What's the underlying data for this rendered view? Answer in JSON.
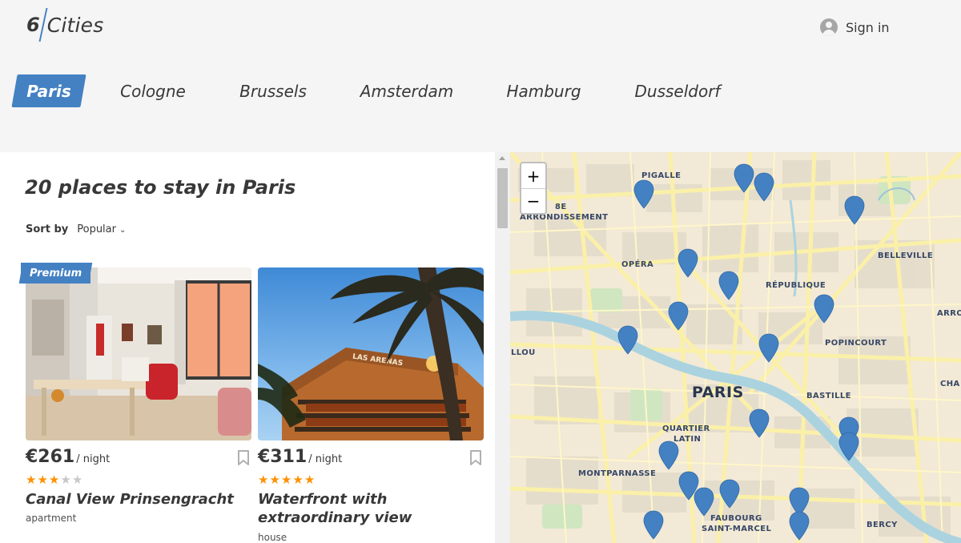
{
  "header": {
    "logo": {
      "number": "6",
      "word": "Cities"
    },
    "sign_in_label": "Sign in"
  },
  "city_tabs": [
    {
      "label": "Paris",
      "active": true
    },
    {
      "label": "Cologne",
      "active": false
    },
    {
      "label": "Brussels",
      "active": false
    },
    {
      "label": "Amsterdam",
      "active": false
    },
    {
      "label": "Hamburg",
      "active": false
    },
    {
      "label": "Dusseldorf",
      "active": false
    }
  ],
  "listing": {
    "title": "20 places to stay in Paris",
    "sort_label": "Sort by",
    "sort_value": "Popular"
  },
  "offers": [
    {
      "premium_label": "Premium",
      "price": "€261",
      "price_unit": "/ night",
      "rating": 3,
      "rating_max": 5,
      "name": "Canal View Prinsengracht",
      "type": "apartment",
      "image_icon": "apartment-interior-photo"
    },
    {
      "premium_label": "",
      "price": "€311",
      "price_unit": "/ night",
      "rating": 5,
      "rating_max": 5,
      "name": "Waterfront with extraordinary view",
      "type": "house",
      "image_icon": "hotel-with-palm-tree-photo",
      "sign_text": "LAS ARENAS"
    }
  ],
  "map": {
    "zoom_in": "+",
    "zoom_out": "−",
    "labels": {
      "pigalle": "PIGALLE",
      "arr8_a": "8E",
      "arr8_b": "ARRONDISSEMENT",
      "opera": "OPÉRA",
      "republique": "RÉPUBLIQUE",
      "belleville": "BELLEVILLE",
      "arro": "ARRO",
      "llou": "LLOU",
      "popincourt": "POPINCOURT",
      "cha": "CHA",
      "paris": "PARIS",
      "bastille": "BASTILLE",
      "quartier_a": "QUARTIER",
      "quartier_b": "LATIN",
      "montparnasse": "MONTPARNASSE",
      "faubourg_a": "FAUBOURG",
      "faubourg_b": "SAINT-MARCEL",
      "bercy": "BERCY"
    },
    "pin_count": 20,
    "colors": {
      "accent": "#4481c3",
      "pin": "#4481c3",
      "star": "#ff9000"
    }
  }
}
